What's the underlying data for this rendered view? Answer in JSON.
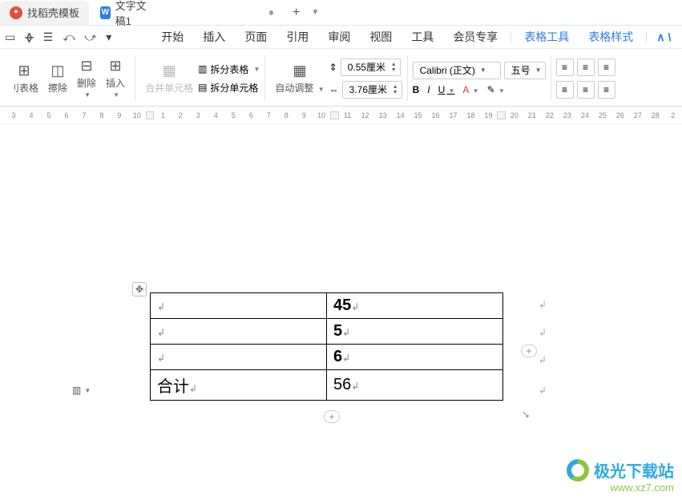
{
  "tabs": {
    "a": "找稻壳模板",
    "b": "文字文稿1"
  },
  "qat": [
    "▭",
    "ᚖ",
    "☰",
    "⤺",
    "⤻",
    "▾"
  ],
  "menu": {
    "items": [
      "开始",
      "插入",
      "页面",
      "引用",
      "审阅",
      "视图",
      "工具",
      "会员专享"
    ],
    "tools": {
      "a": "表格工具",
      "b": "表格样式"
    }
  },
  "ribbon": {
    "cols": {
      "delTable": "刂表格",
      "erase": "擦除",
      "delete": "删除",
      "insert": "插入"
    },
    "merge": {
      "label": "合并单元格",
      "splitTbl": "拆分表格",
      "splitCell": "拆分单元格"
    },
    "fit": {
      "auto": "自动调整",
      "row": "0.55厘米",
      "col": "3.76厘米"
    },
    "font": {
      "name": "Calibri (正文)",
      "size": "五号"
    },
    "style": {
      "b": "B",
      "i": "I",
      "u": "U",
      "a": "A"
    }
  },
  "ruler": [
    "3",
    "4",
    "5",
    "6",
    "7",
    "8",
    "9",
    "10",
    "▦",
    "1",
    "2",
    "3",
    "4",
    "5",
    "6",
    "7",
    "8",
    "9",
    "10",
    "▦",
    "11",
    "12",
    "13",
    "14",
    "15",
    "16",
    "17",
    "18",
    "19",
    "▦",
    "20",
    "21",
    "22",
    "23",
    "24",
    "25",
    "26",
    "27",
    "28",
    "2"
  ],
  "table": {
    "rows": [
      {
        "l": "",
        "r": "45"
      },
      {
        "l": "",
        "r": "5"
      },
      {
        "l": "",
        "r": "6"
      },
      {
        "l": "合计",
        "r": "56"
      }
    ]
  },
  "watermark": {
    "title": "极光下载站",
    "url": "www.xz7.com"
  }
}
